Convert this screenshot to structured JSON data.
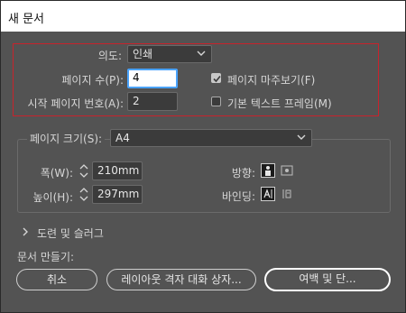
{
  "window": {
    "title": "새 문서"
  },
  "top": {
    "intent_label": "의도:",
    "intent_value": "인쇄",
    "pages_label": "페이지 수(P):",
    "pages_value": "4",
    "start_page_label": "시작 페이지 번호(A):",
    "start_page_value": "2",
    "facing_pages_label": "페이지 마주보기(F)",
    "facing_pages_checked": true,
    "primary_text_frame_label": "기본 텍스트 프레임(M)",
    "primary_text_frame_checked": false
  },
  "page_size": {
    "label": "페이지 크기(S):",
    "value": "A4",
    "width_label": "폭(W):",
    "width_value": "210mm",
    "height_label": "높이(H):",
    "height_value": "297mm",
    "orientation_label": "방향:",
    "binding_label": "바인딩:"
  },
  "bleed": {
    "label": "도련 및 슬러그"
  },
  "create": {
    "label": "문서 만들기:",
    "cancel": "취소",
    "layout_grid": "레이아웃 격자 대화 상자...",
    "margins_columns": "여백 및 단..."
  },
  "colors": {
    "panel": "#535353",
    "highlight_border": "#c8232c",
    "focus": "#4aa3ff"
  }
}
